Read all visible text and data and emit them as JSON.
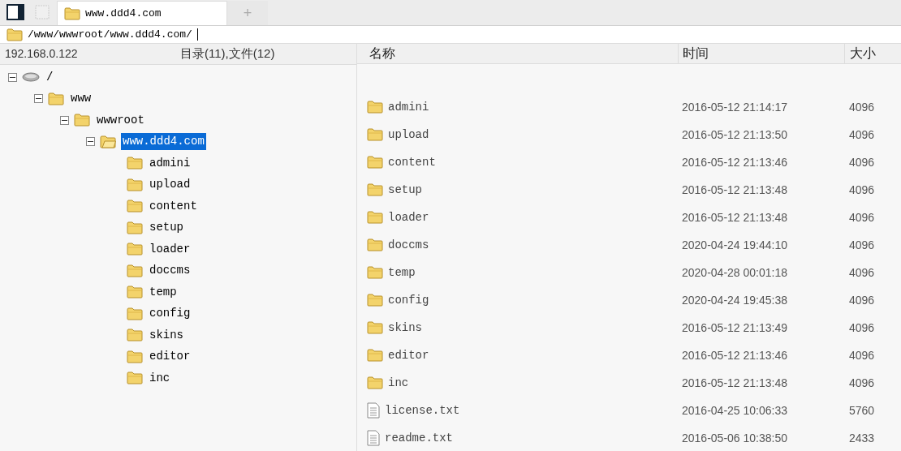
{
  "tabs": [
    {
      "label": "www.ddd4.com",
      "selected": true
    }
  ],
  "new_tab": "+",
  "address": {
    "value": "/www/wwwroot/www.ddd4.com/"
  },
  "left_header": {
    "host": "192.168.0.122",
    "summary": "目录(11),文件(12)"
  },
  "tree": [
    {
      "name": "/",
      "kind": "drive",
      "expanded": true,
      "selected": false,
      "children": [
        {
          "name": "www",
          "kind": "folder",
          "expanded": true,
          "selected": false,
          "children": [
            {
              "name": "wwwroot",
              "kind": "folder",
              "expanded": true,
              "selected": false,
              "children": [
                {
                  "name": "www.ddd4.com",
                  "kind": "folder",
                  "expanded": true,
                  "selected": true,
                  "children": [
                    {
                      "name": "admini",
                      "kind": "folder",
                      "selected": false
                    },
                    {
                      "name": "upload",
                      "kind": "folder",
                      "selected": false
                    },
                    {
                      "name": "content",
                      "kind": "folder",
                      "selected": false
                    },
                    {
                      "name": "setup",
                      "kind": "folder",
                      "selected": false
                    },
                    {
                      "name": "loader",
                      "kind": "folder",
                      "selected": false
                    },
                    {
                      "name": "doccms",
                      "kind": "folder",
                      "selected": false
                    },
                    {
                      "name": "temp",
                      "kind": "folder",
                      "selected": false
                    },
                    {
                      "name": "config",
                      "kind": "folder",
                      "selected": false
                    },
                    {
                      "name": "skins",
                      "kind": "folder",
                      "selected": false
                    },
                    {
                      "name": "editor",
                      "kind": "folder",
                      "selected": false
                    },
                    {
                      "name": "inc",
                      "kind": "folder",
                      "selected": false
                    }
                  ]
                }
              ]
            }
          ]
        }
      ]
    }
  ],
  "table": {
    "columns": [
      "名称",
      "时间",
      "大小"
    ],
    "rows": [
      {
        "kind": "folder",
        "name": "admini",
        "time": "2016-05-12 21:14:17",
        "size": "4096"
      },
      {
        "kind": "folder",
        "name": "upload",
        "time": "2016-05-12 21:13:50",
        "size": "4096"
      },
      {
        "kind": "folder",
        "name": "content",
        "time": "2016-05-12 21:13:46",
        "size": "4096"
      },
      {
        "kind": "folder",
        "name": "setup",
        "time": "2016-05-12 21:13:48",
        "size": "4096"
      },
      {
        "kind": "folder",
        "name": "loader",
        "time": "2016-05-12 21:13:48",
        "size": "4096"
      },
      {
        "kind": "folder",
        "name": "doccms",
        "time": "2020-04-24 19:44:10",
        "size": "4096"
      },
      {
        "kind": "folder",
        "name": "temp",
        "time": "2020-04-28 00:01:18",
        "size": "4096"
      },
      {
        "kind": "folder",
        "name": "config",
        "time": "2020-04-24 19:45:38",
        "size": "4096"
      },
      {
        "kind": "folder",
        "name": "skins",
        "time": "2016-05-12 21:13:49",
        "size": "4096"
      },
      {
        "kind": "folder",
        "name": "editor",
        "time": "2016-05-12 21:13:46",
        "size": "4096"
      },
      {
        "kind": "folder",
        "name": "inc",
        "time": "2016-05-12 21:13:48",
        "size": "4096"
      },
      {
        "kind": "file",
        "name": "license.txt",
        "time": "2016-04-25 10:06:33",
        "size": "5760"
      },
      {
        "kind": "file",
        "name": "readme.txt",
        "time": "2016-05-06 10:38:50",
        "size": "2433"
      }
    ]
  }
}
